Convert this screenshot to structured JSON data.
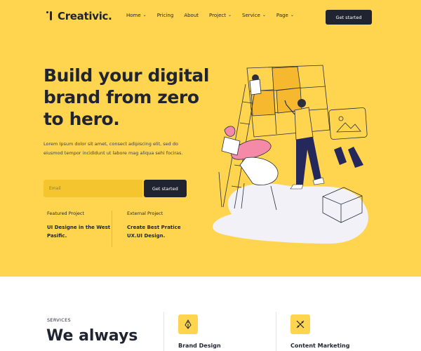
{
  "brand": {
    "name": "Creativic."
  },
  "nav": {
    "items": [
      {
        "label": "Home",
        "dropdown": true
      },
      {
        "label": "Pricing",
        "dropdown": false
      },
      {
        "label": "About",
        "dropdown": false
      },
      {
        "label": "Project",
        "dropdown": true
      },
      {
        "label": "Service",
        "dropdown": true
      },
      {
        "label": "Page",
        "dropdown": true
      }
    ],
    "cta": "Get started"
  },
  "hero": {
    "headline": "Build your digital brand from zero to hero.",
    "subtext": "Lorem Ipsum dolor sit amet, consect adipiscing elit, sed do eiusmod tempor incididunt ut labore mag aliqua sehi fociras.",
    "email_placeholder": "Email",
    "email_button": "Get started",
    "projects": [
      {
        "label": "Featured Project",
        "title": "UI Designe in the West Pasific."
      },
      {
        "label": "External Project",
        "title": "Create Best Pratice UX.UI Design."
      }
    ]
  },
  "services": {
    "label": "SERVICES",
    "heading": "We always",
    "cards": [
      {
        "title": "Brand Design",
        "icon": "pen-nib-icon"
      },
      {
        "title": "Content Marketing",
        "icon": "pencil-ruler-icon"
      }
    ]
  },
  "colors": {
    "hero_bg": "#ffd54f",
    "dark": "#1f2430",
    "accent_pink": "#f48aa8",
    "accent_navy": "#24285b"
  }
}
